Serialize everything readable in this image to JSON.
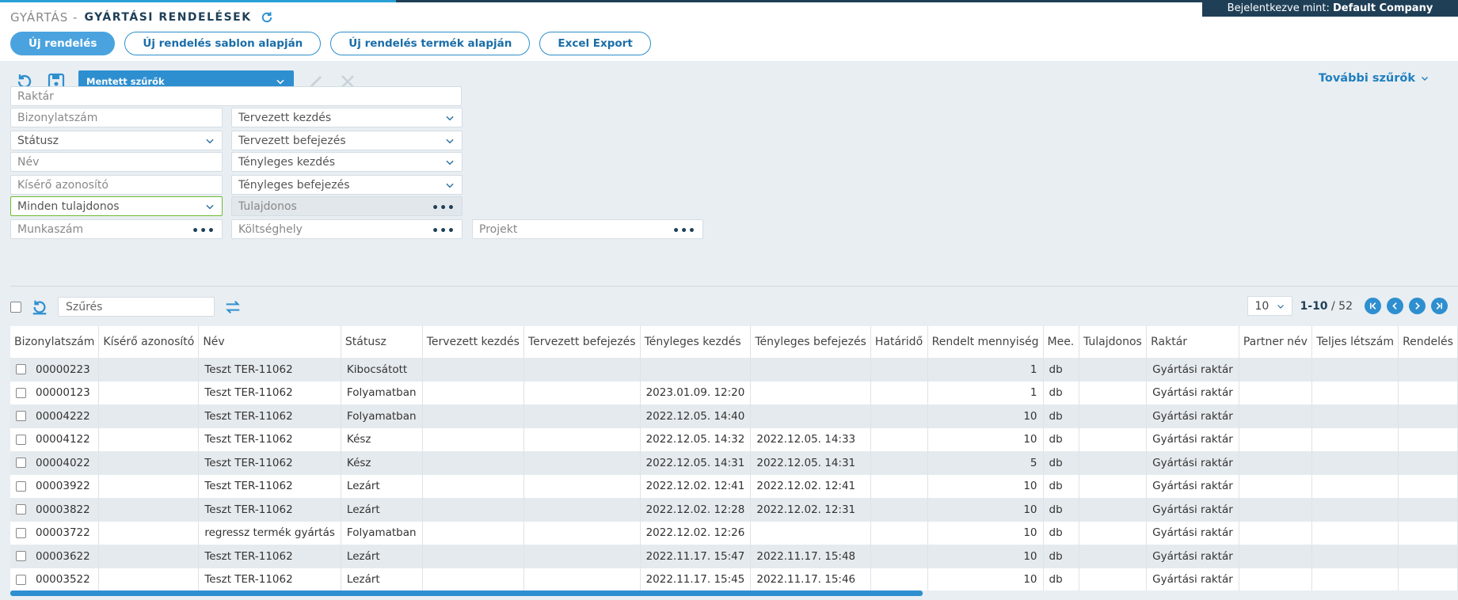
{
  "login": {
    "prefix": "Bejelentkezve mint:",
    "user": "Default Company"
  },
  "header": {
    "crumb": "GYÁRTÁS -",
    "title": "GYÁRTÁSI RENDELÉSEK"
  },
  "buttons": {
    "new_order": "Új rendelés",
    "new_from_template": "Új rendelés sablon alapján",
    "new_from_product": "Új rendelés termék alapján",
    "excel_export": "Excel Export"
  },
  "filters": {
    "saved_filters": "Mentett szűrők",
    "more_filters": "További szűrők",
    "warehouse": "Raktár",
    "doc_number": "Bizonylatszám",
    "planned_start": "Tervezett kezdés",
    "status": "Státusz",
    "planned_end": "Tervezett befejezés",
    "name": "Név",
    "actual_start": "Tényleges kezdés",
    "tracking_id": "Kísérő azonosító",
    "actual_end": "Tényleges befejezés",
    "owner_select": "Minden tulajdonos",
    "owner": "Tulajdonos",
    "job_number": "Munkaszám",
    "cost_center": "Költséghely",
    "project": "Projekt"
  },
  "grid_toolbar": {
    "search_placeholder": "Szűrés"
  },
  "pager": {
    "page_size": "10",
    "range": "1-10",
    "total": "/ 52"
  },
  "table": {
    "headers": [
      "Bizonylatszám",
      "Kísérő azonosító",
      "Név",
      "Státusz",
      "Tervezett kezdés",
      "Tervezett befejezés",
      "Tényleges kezdés",
      "Tényleges befejezés",
      "Határidő",
      "Rendelt mennyiség",
      "Mee.",
      "Tulajdonos",
      "Raktár",
      "Partner név",
      "Teljes létszám",
      "Rendelés"
    ],
    "rows": [
      [
        "00000223",
        "",
        "Teszt TER-11062",
        "Kibocsátott",
        "",
        "",
        "",
        "",
        "",
        "1",
        "db",
        "",
        "Gyártási raktár",
        "",
        "",
        ""
      ],
      [
        "00000123",
        "",
        "Teszt TER-11062",
        "Folyamatban",
        "",
        "",
        "2023.01.09. 12:20",
        "",
        "",
        "1",
        "db",
        "",
        "Gyártási raktár",
        "",
        "",
        ""
      ],
      [
        "00004222",
        "",
        "Teszt TER-11062",
        "Folyamatban",
        "",
        "",
        "2022.12.05. 14:40",
        "",
        "",
        "10",
        "db",
        "",
        "Gyártási raktár",
        "",
        "",
        ""
      ],
      [
        "00004122",
        "",
        "Teszt TER-11062",
        "Kész",
        "",
        "",
        "2022.12.05. 14:32",
        "2022.12.05. 14:33",
        "",
        "10",
        "db",
        "",
        "Gyártási raktár",
        "",
        "",
        ""
      ],
      [
        "00004022",
        "",
        "Teszt TER-11062",
        "Kész",
        "",
        "",
        "2022.12.05. 14:31",
        "2022.12.05. 14:31",
        "",
        "5",
        "db",
        "",
        "Gyártási raktár",
        "",
        "",
        ""
      ],
      [
        "00003922",
        "",
        "Teszt TER-11062",
        "Lezárt",
        "",
        "",
        "2022.12.02. 12:41",
        "2022.12.02. 12:41",
        "",
        "10",
        "db",
        "",
        "Gyártási raktár",
        "",
        "",
        ""
      ],
      [
        "00003822",
        "",
        "Teszt TER-11062",
        "Lezárt",
        "",
        "",
        "2022.12.02. 12:28",
        "2022.12.02. 12:31",
        "",
        "10",
        "db",
        "",
        "Gyártási raktár",
        "",
        "",
        ""
      ],
      [
        "00003722",
        "",
        "regressz termék gyártás",
        "Folyamatban",
        "",
        "",
        "2022.12.02. 12:26",
        "",
        "",
        "10",
        "db",
        "",
        "Gyártási raktár",
        "",
        "",
        ""
      ],
      [
        "00003622",
        "",
        "Teszt TER-11062",
        "Lezárt",
        "",
        "",
        "2022.11.17. 15:47",
        "2022.11.17. 15:48",
        "",
        "10",
        "db",
        "",
        "Gyártási raktár",
        "",
        "",
        ""
      ],
      [
        "00003522",
        "",
        "Teszt TER-11062",
        "Lezárt",
        "",
        "",
        "2022.11.17. 15:45",
        "2022.11.17. 15:46",
        "",
        "10",
        "db",
        "",
        "Gyártási raktár",
        "",
        "",
        ""
      ]
    ]
  }
}
